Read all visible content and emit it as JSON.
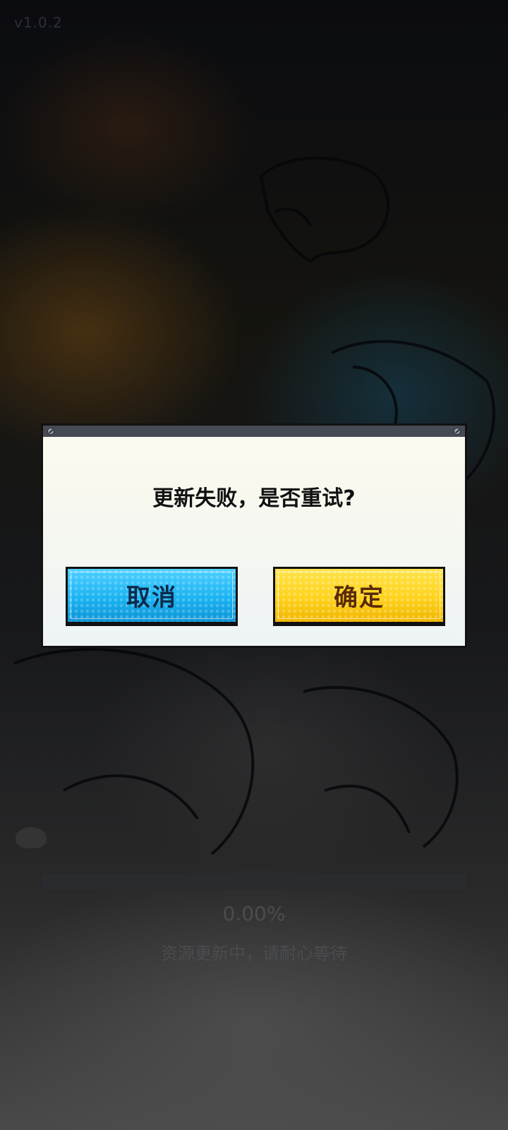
{
  "version": "v1.0.2",
  "dialog": {
    "title": "更新失败，是否重试?",
    "cancel_label": "取消",
    "confirm_label": "确定"
  },
  "loading": {
    "percent_text": "0.00%",
    "progress_fraction": 0.0,
    "status_text": "资源更新中，请耐心等待"
  },
  "colors": {
    "cancel_button": "#1ab3f2",
    "confirm_button": "#ffd21b",
    "dialog_bar": "#454a55"
  }
}
